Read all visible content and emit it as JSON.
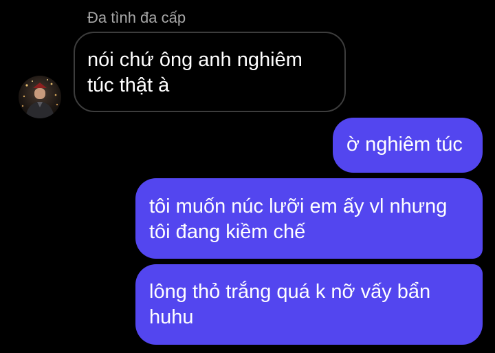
{
  "thread": {
    "sender_name": "Đa tình đa cấp",
    "avatar_icon": "user-avatar-photo",
    "messages": [
      {
        "from": "them",
        "lines": [
          "nói chứ ông anh nghiêm",
          "túc thật à"
        ]
      },
      {
        "from": "me",
        "lines": [
          "ờ nghiêm túc"
        ]
      },
      {
        "from": "me",
        "lines": [
          "tôi muốn núc lưỡi em ấy vl nhưng",
          "tôi đang kiềm chế"
        ]
      },
      {
        "from": "me",
        "lines": [
          "lông thỏ trắng quá k nỡ vấy bẩn",
          "huhu"
        ]
      }
    ]
  },
  "colors": {
    "background": "#000000",
    "outgoing_bubble": "#5346ef",
    "incoming_border": "#3d3d3d",
    "sender_name": "#a7a7a7",
    "text": "#ffffff"
  }
}
